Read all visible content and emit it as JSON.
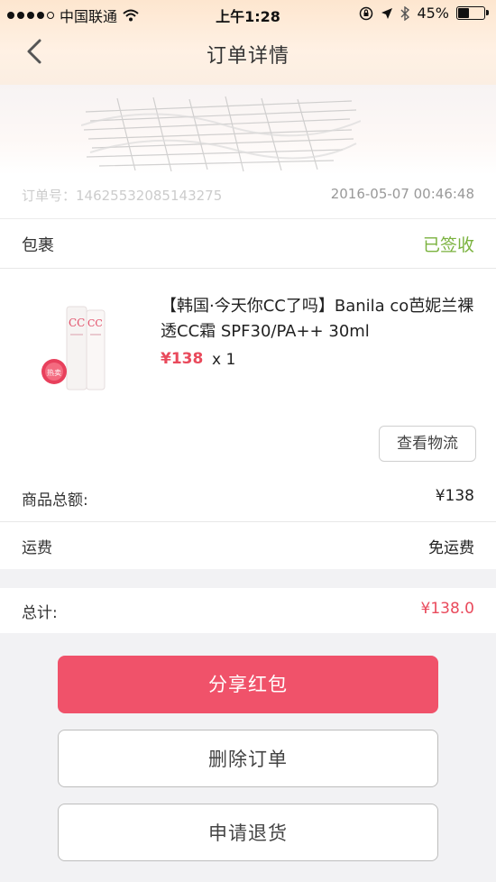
{
  "status_bar": {
    "carrier": "中国联通",
    "time": "上午1:28",
    "battery": "45%",
    "battery_level": 0.45,
    "signal_bars_filled": 4,
    "icons": [
      "signal-dots-icon",
      "wifi-icon",
      "lock-rotation-icon",
      "location-arrow-icon",
      "bluetooth-icon",
      "battery-icon"
    ]
  },
  "nav": {
    "title": "订单详情",
    "back_icon": "chevron-left-icon"
  },
  "order": {
    "number": "订单号：14625532085143275",
    "date": "2016-05-07 00:46:48"
  },
  "package": {
    "label": "包裹",
    "status": "已签收",
    "status_color": "#7ab23e"
  },
  "product": {
    "name": "【韩国·今天你CC了吗】Banila co芭妮兰裸透CC霜 SPF30/PA++ 30ml",
    "price": "¥138",
    "quantity": "x 1",
    "thumb_badge": "热卖",
    "logistics_button": "查看物流"
  },
  "summary": {
    "subtotal_label": "商品总额:",
    "subtotal_value": "¥138",
    "shipping_label": "运费",
    "shipping_value": "免运费",
    "total_label": "总计:",
    "total_value": "¥138.0",
    "accent_color": "#e94a5c"
  },
  "actions": {
    "share": "分享红包",
    "delete": "删除订单",
    "refund": "申请退货",
    "primary_color": "#f0526a"
  }
}
